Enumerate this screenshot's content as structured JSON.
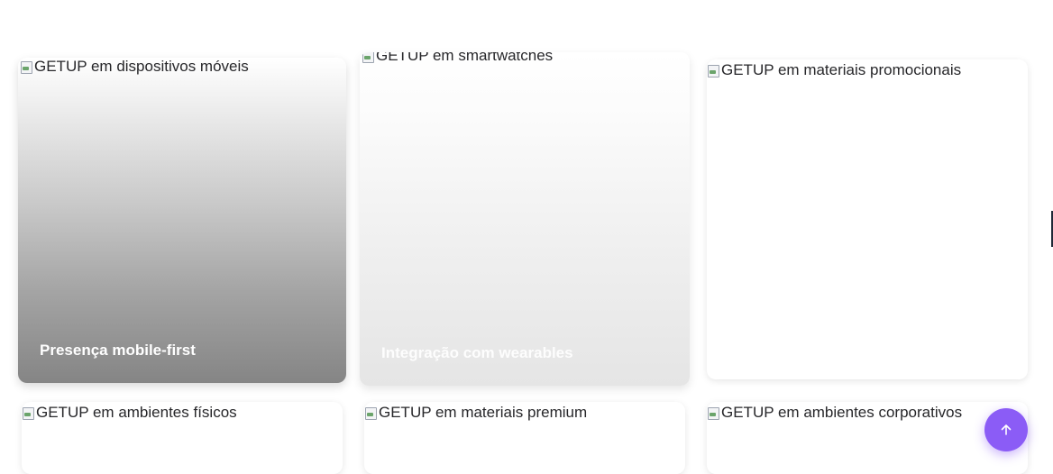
{
  "gallery": {
    "items": [
      {
        "alt": "GETUP em dispositivos móveis",
        "caption": "Presença mobile-first"
      },
      {
        "alt": "GETUP em smartwatches",
        "caption": "Integração com wearables"
      },
      {
        "alt": "GETUP em materiais promocionais",
        "caption": ""
      },
      {
        "alt": "GETUP em ambientes físicos",
        "caption": ""
      },
      {
        "alt": "GETUP em materiais premium",
        "caption": ""
      },
      {
        "alt": "GETUP em ambientes corporativos",
        "caption": ""
      }
    ]
  },
  "scroll_top": {
    "icon": "arrow-up-icon",
    "color": "#8b5cf6"
  }
}
